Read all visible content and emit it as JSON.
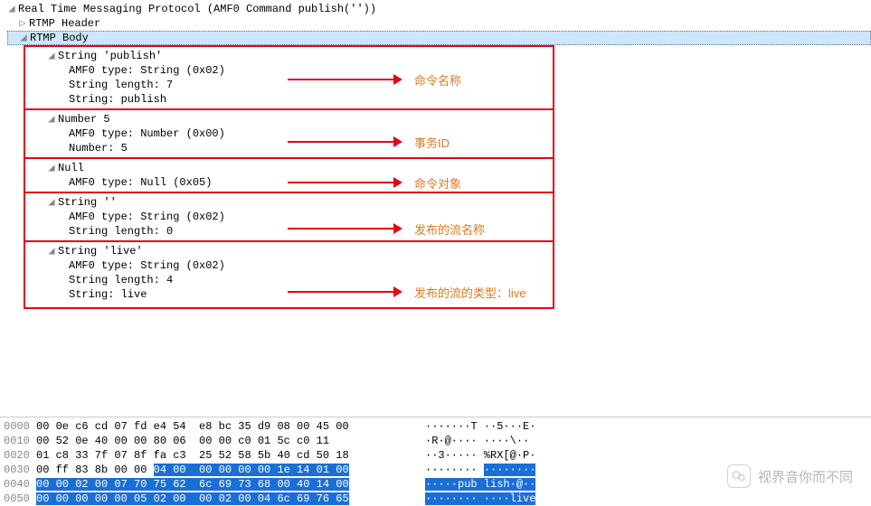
{
  "title": "Real Time Messaging Protocol (AMF0 Command publish(''))",
  "header_label": "RTMP Header",
  "body_label": "RTMP Body",
  "groups": [
    {
      "title": "String 'publish'",
      "rows": [
        "AMF0 type: String (0x02)",
        "String length: 7",
        "String: publish"
      ],
      "annotation": "命令名称"
    },
    {
      "title": "Number 5",
      "rows": [
        "AMF0 type: Number (0x00)",
        "Number: 5"
      ],
      "annotation": "事务ID"
    },
    {
      "title": "Null",
      "rows": [
        "AMF0 type: Null (0x05)"
      ],
      "annotation": "命令对象"
    },
    {
      "title": "String ''",
      "rows": [
        "AMF0 type: String (0x02)",
        "String length: 0"
      ],
      "annotation": "发布的流名称"
    },
    {
      "title": "String 'live'",
      "rows": [
        "AMF0 type: String (0x02)",
        "String length: 4",
        "String: live"
      ],
      "annotation": "发布的流的类型：live"
    }
  ],
  "hex": [
    {
      "off": "0000",
      "b": "00 0e c6 cd 07 fd e4 54  e8 bc 35 d9 08 00 45 00",
      "a": "·······T ··5···E·"
    },
    {
      "off": "0010",
      "b": "00 52 0e 40 00 00 80 06  00 00 c0 01 5c c0 11",
      "a": "·R·@···· ····\\··"
    },
    {
      "off": "0020",
      "b": "01 c8 33 7f 07 8f fa c3  25 52 58 5b 40 cd 50 18",
      "a": "··3····· %RX[@·P·"
    },
    {
      "off": "0030",
      "b": "00 ff 83 8b 00 00 ",
      "bs": "04 00  00 00 00 00 1e 14 01 00",
      "a": "········ ",
      "as": "········"
    },
    {
      "off": "0040",
      "b": "",
      "bs": "00 00 02 00 07 70 75 62  6c 69 73 68 00 40 14 00",
      "a": "",
      "as": "·····pub lish·@··"
    },
    {
      "off": "0050",
      "b": "",
      "bs": "00 00 00 00 00 05 02 00  00 02 00 04 6c 69 76 65",
      "a": "",
      "as": "········ ····live"
    }
  ],
  "watermark": "视界音你而不同"
}
